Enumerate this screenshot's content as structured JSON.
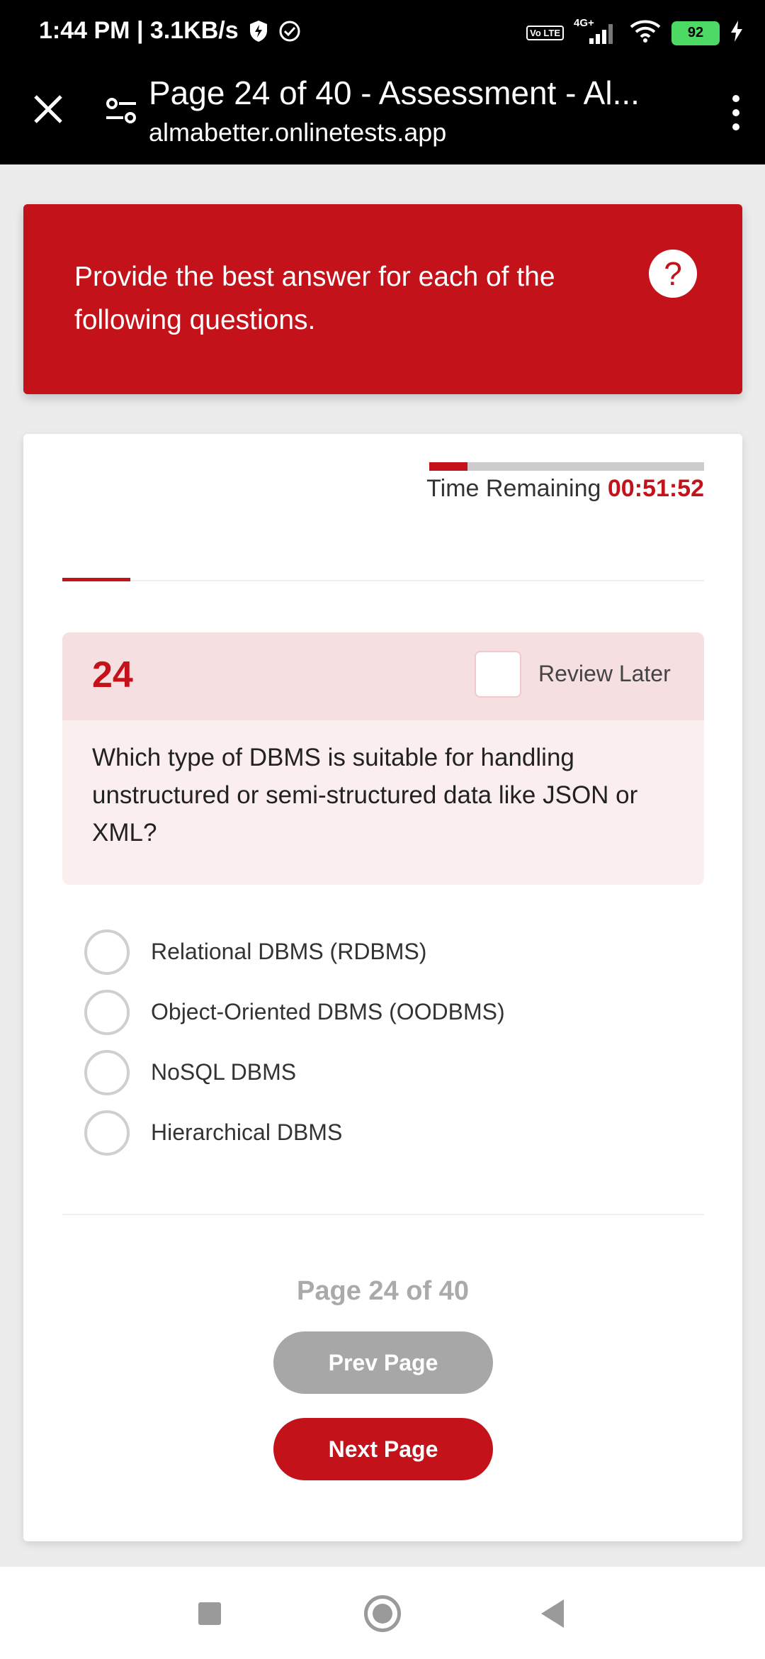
{
  "status_bar": {
    "time_speed": "1:44 PM | 3.1KB/s",
    "network": "4G+",
    "volte": "Vo LTE",
    "battery": "92"
  },
  "browser": {
    "title": "Page 24 of 40 - Assessment - Al...",
    "url": "almabetter.onlinetests.app"
  },
  "banner": {
    "instruction": "Provide the best answer for each of the following questions.",
    "help": "?"
  },
  "timer": {
    "label": "Time Remaining",
    "value": "00:51:52",
    "progress_fraction": 0.14
  },
  "question": {
    "number": "24",
    "review_label": "Review Later",
    "text": "Which type of DBMS is suitable for handling unstructured or semi-structured data like JSON or XML?",
    "options": [
      "Relational DBMS (RDBMS)",
      "Object-Oriented DBMS (OODBMS)",
      "NoSQL DBMS",
      "Hierarchical DBMS"
    ]
  },
  "pager": {
    "text": "Page 24 of 40",
    "prev_label": "Prev Page",
    "next_label": "Next Page"
  },
  "colors": {
    "brand_red": "#c4121a",
    "header_tint": "#f6dfe1",
    "body_tint": "#faeeee",
    "disabled_gray": "#a7a7a7"
  }
}
